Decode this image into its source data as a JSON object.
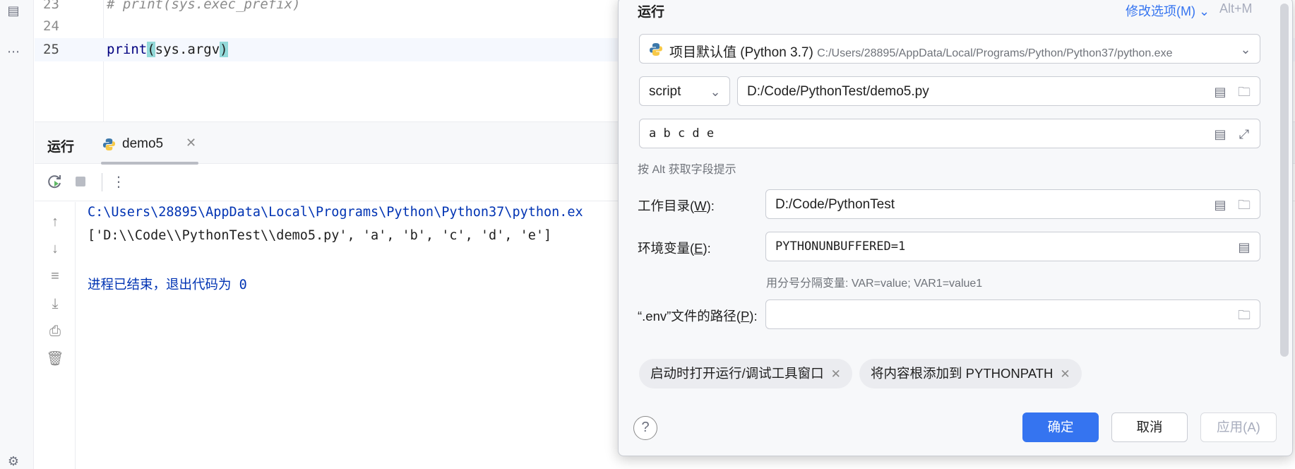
{
  "editor": {
    "lines": [
      {
        "number": "23",
        "text": "# print(sys.exec_prefix)"
      },
      {
        "number": "24",
        "text": ""
      },
      {
        "number": "25",
        "func": "print",
        "open": "(",
        "arg": "sys.argv",
        "close": ")"
      }
    ]
  },
  "run_panel": {
    "title": "运行",
    "tab_label": "demo5",
    "console": {
      "path_line": "C:\\Users\\28895\\AppData\\Local\\Programs\\Python\\Python37\\python.ex",
      "output_line": "['D:\\\\Code\\\\PythonTest\\\\demo5.py', 'a', 'b', 'c', 'd', 'e']",
      "exit_line": "进程已结束，退出代码为 0"
    }
  },
  "dialog": {
    "title": "运行",
    "modify_options": "修改选项(M)",
    "modify_shortcut": "Alt+M",
    "interpreter": {
      "name": "项目默认值 (Python 3.7)",
      "path": "C:/Users/28895/AppData/Local/Programs/Python/Python37/python.exe"
    },
    "script_type": "script",
    "script_path": "D:/Code/PythonTest/demo5.py",
    "parameters": "a b c d e",
    "alt_hint": "按 Alt 获取字段提示",
    "working_dir": {
      "label_pre": "工作目录(",
      "label_key": "W",
      "label_post": "):",
      "value": "D:/Code/PythonTest"
    },
    "env_vars": {
      "label_pre": "环境变量(",
      "label_key": "E",
      "label_post": "):",
      "value": "PYTHONUNBUFFERED=1",
      "hint": "用分号分隔变量: VAR=value; VAR1=value1"
    },
    "env_file": {
      "label_pre": "“.env”文件的路径(",
      "label_key": "P",
      "label_post": "):",
      "value": ""
    },
    "chips": [
      "启动时打开运行/调试工具窗口",
      "将内容根添加到 PYTHONPATH"
    ],
    "buttons": {
      "ok": "确定",
      "cancel": "取消",
      "apply": "应用(A)"
    }
  },
  "colors": {
    "accent": "#3574f0",
    "console_blue": "#0033b3",
    "paren_highlight": "#93d9d9"
  }
}
